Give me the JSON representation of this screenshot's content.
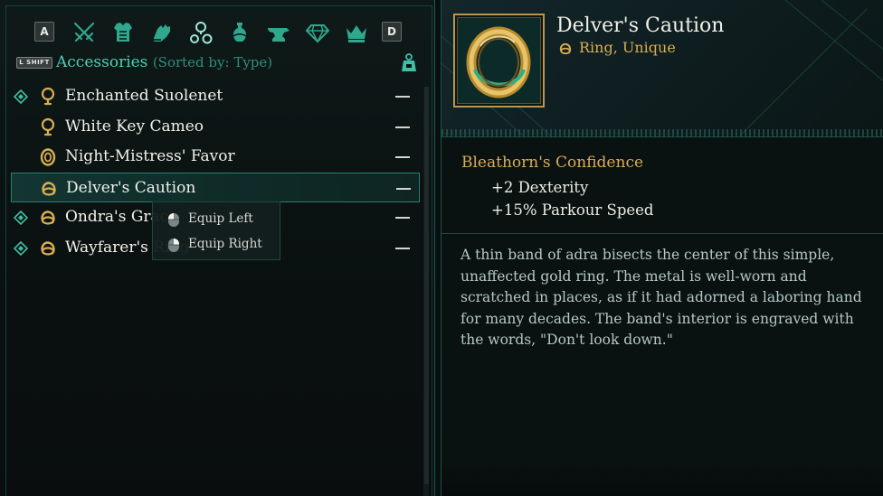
{
  "tabbar": {
    "left_key": "A",
    "right_key": "D",
    "tabs": [
      {
        "icon": "crossed-swords-icon",
        "active": false
      },
      {
        "icon": "chest-armor-icon",
        "active": false
      },
      {
        "icon": "gauntlet-icon",
        "active": false
      },
      {
        "icon": "accessories-icon",
        "active": true
      },
      {
        "icon": "potion-icon",
        "active": false
      },
      {
        "icon": "anvil-icon",
        "active": false
      },
      {
        "icon": "gem-icon",
        "active": false
      },
      {
        "icon": "crown-icon",
        "active": false
      }
    ]
  },
  "subheader": {
    "shift_key": "L SHIFT",
    "category": "Accessories",
    "sort_label": "(Sorted by: Type)",
    "sort_icon": "weight-icon"
  },
  "items": [
    {
      "name": "Enchanted Suolenet",
      "icon": "amulet-icon",
      "marker": "new-diamond-icon",
      "value": "—",
      "selected": false
    },
    {
      "name": "White Key Cameo",
      "icon": "amulet-icon",
      "marker": "",
      "value": "—",
      "selected": false
    },
    {
      "name": "Night-Mistress' Favor",
      "icon": "ring-icon",
      "marker": "",
      "value": "—",
      "selected": false
    },
    {
      "name": "Delver's Caution",
      "icon": "ring-icon",
      "marker": "",
      "value": "—",
      "selected": true
    },
    {
      "name": "Ondra's Grace",
      "icon": "ring-icon",
      "marker": "new-diamond-icon",
      "value": "—",
      "selected": false
    },
    {
      "name": "Wayfarer's Ring",
      "icon": "ring-icon",
      "marker": "new-diamond-icon",
      "value": "—",
      "selected": false
    }
  ],
  "context_menu": {
    "equip_left": "Equip Left",
    "equip_right": "Equip Right"
  },
  "detail": {
    "title": "Delver's Caution",
    "type": "Ring, Unique",
    "perk_name": "Bleathorn's Confidence",
    "stats": [
      "+2 Dexterity",
      "+15% Parkour Speed"
    ],
    "description": "A thin band of adra bisects the center of this simple, unaffected gold ring. The metal is well-worn and scratched in places, as if it had adorned a laboring hand for many decades. The band's interior is engraved with the words, \"Don't look down.\""
  },
  "colors": {
    "accent_teal": "#4fcfb2",
    "gold": "#d9ae52",
    "background": "#0a1111"
  }
}
